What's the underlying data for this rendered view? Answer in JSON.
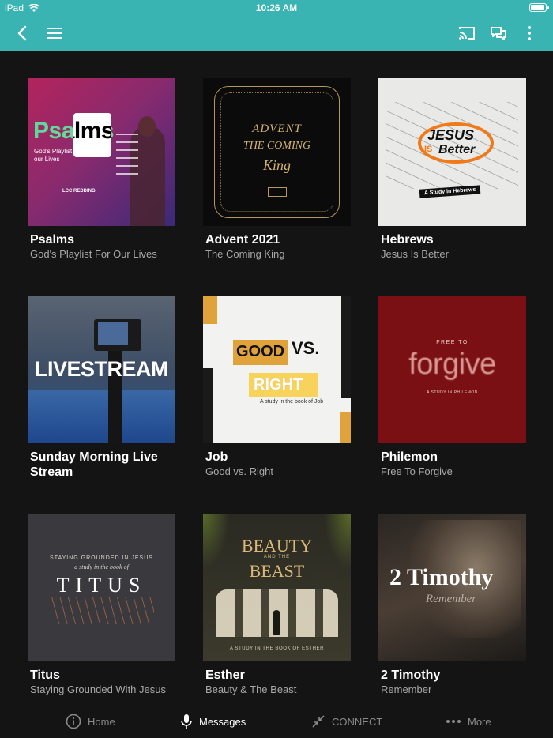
{
  "status": {
    "device": "iPad",
    "time": "10:26 AM",
    "battery_level": 0.9
  },
  "appbar": {
    "back_icon": "chevron-left-icon",
    "menu_icon": "hamburger-icon",
    "cast_icon": "cast-icon",
    "chat_icon": "chat-icon",
    "more_icon": "vertical-dots-icon"
  },
  "series": [
    {
      "title": "Psalms",
      "subtitle": "God's Playlist For Our Lives",
      "art": {
        "big": "Psalms",
        "tag": "God's Playlist for our Lives",
        "small": "LCC REDDING"
      }
    },
    {
      "title": "Advent 2021",
      "subtitle": "The Coming King",
      "art": {
        "line1": "ADVENT",
        "line2": "THE COMING",
        "line3": "King"
      }
    },
    {
      "title": "Hebrews",
      "subtitle": "Jesus Is Better",
      "art": {
        "line1": "JESUS",
        "line2": "IS",
        "line3": "Better",
        "band": "A Study in Hebrews"
      }
    },
    {
      "title": "Sunday Morning Live Stream",
      "subtitle": "",
      "art": {
        "big": "LIVESTREAM"
      }
    },
    {
      "title": "Job",
      "subtitle": "Good vs. Right",
      "art": {
        "good": "GOOD",
        "vs": "VS.",
        "right": "RIGHT",
        "caption": "A study in the book of Job"
      }
    },
    {
      "title": "Philemon",
      "subtitle": "Free To Forgive",
      "art": {
        "top": "FREE TO",
        "big": "forgive",
        "bottom": "A STUDY IN PHILEMON"
      }
    },
    {
      "title": "Titus",
      "subtitle": "Staying Grounded With Jesus",
      "art": {
        "top": "STAYING GROUNDED IN JESUS",
        "mid": "a study in the book of",
        "big": "TITUS"
      }
    },
    {
      "title": "Esther",
      "subtitle": "Beauty & The Beast",
      "art": {
        "line1": "BEAUTY",
        "line2": "AND THE",
        "line3": "BEAST",
        "bottom": "A STUDY IN THE BOOK OF ESTHER"
      }
    },
    {
      "title": "2 Timothy",
      "subtitle": "Remember",
      "art": {
        "big": "2 Timothy",
        "script": "Remember"
      }
    }
  ],
  "tabs": [
    {
      "label": "Home",
      "icon": "info-circle-icon",
      "active": false
    },
    {
      "label": "Messages",
      "icon": "microphone-icon",
      "active": true
    },
    {
      "label": "CONNECT",
      "icon": "compress-arrows-icon",
      "active": false
    },
    {
      "label": "More",
      "icon": "horizontal-dots-icon",
      "active": false
    }
  ]
}
